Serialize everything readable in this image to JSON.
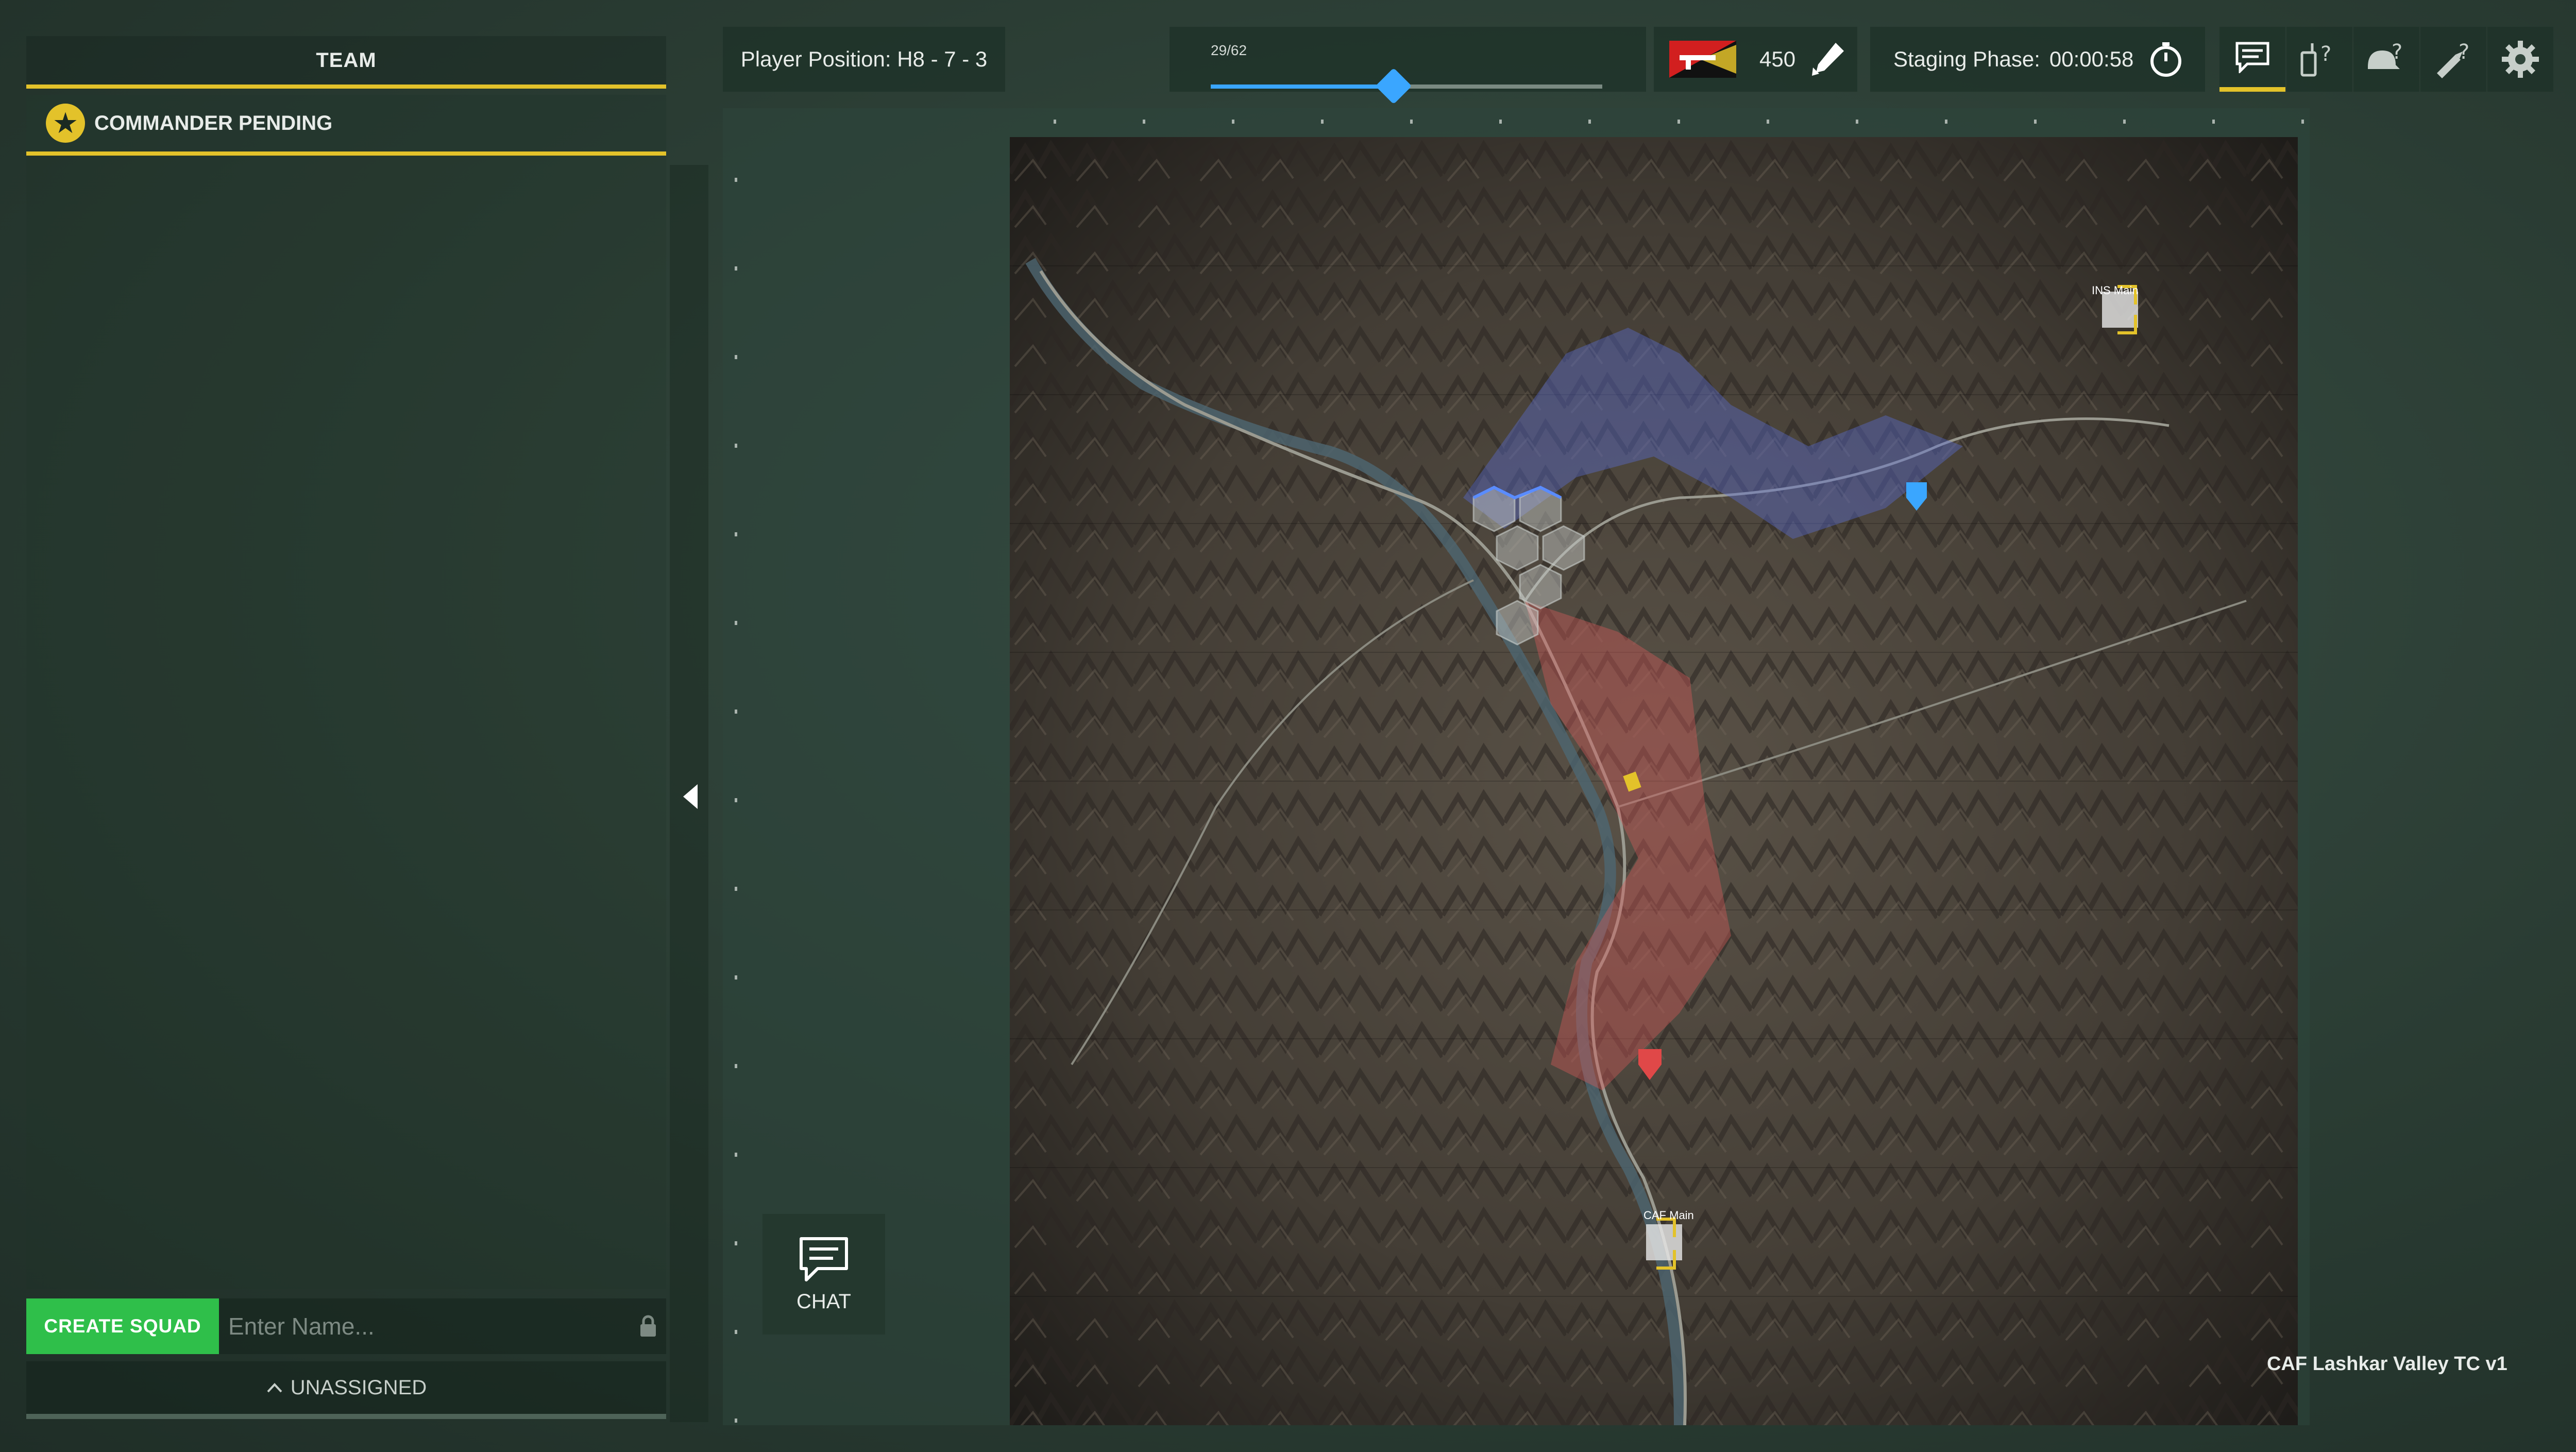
{
  "team": {
    "title": "TEAM",
    "commander_label": "COMMANDER PENDING",
    "create_squad_label": "CREATE SQUAD",
    "squad_name_placeholder": "Enter Name...",
    "unassigned_label": "UNASSIGNED"
  },
  "topbar": {
    "player_position": "Player Position: H8 - 7 - 3",
    "slider_label": "29/62",
    "slider_value": 29,
    "slider_max": 62,
    "points": "450",
    "staging_label": "Staging Phase:",
    "staging_time": "00:00:58"
  },
  "map": {
    "name": "CAF Lashkar Valley TC v1",
    "main_labels": [
      "INS Main",
      "CAF Main"
    ]
  },
  "chat": {
    "label": "CHAT"
  },
  "colors": {
    "accent_yellow": "#e3c22a",
    "create_green": "#2fbf4a",
    "slider_blue": "#3aa6ff",
    "enemy_blue_zone": "#5a6fd6",
    "friendly_red_zone": "#d65a5a"
  },
  "icons": [
    "star-icon",
    "lock-icon",
    "chevron-up-icon",
    "collapse-left-icon",
    "rifle-flag-icon",
    "ammo-icon",
    "timer-icon",
    "chat-icon",
    "radio-help-icon",
    "helmet-help-icon",
    "rocket-help-icon",
    "gear-icon"
  ]
}
